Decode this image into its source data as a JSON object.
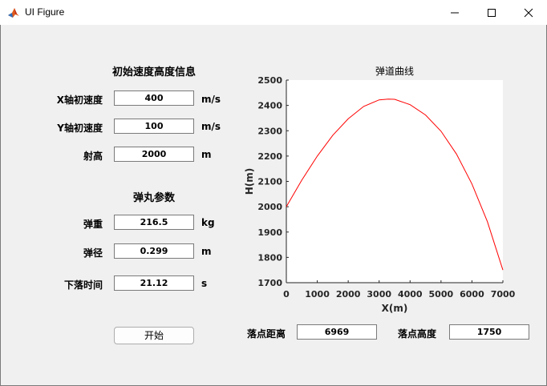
{
  "window": {
    "title": "UI Figure"
  },
  "velocity_section": {
    "title": "初始速度高度信息",
    "x_velocity": {
      "label": "X轴初速度",
      "value": "400",
      "unit": "m/s"
    },
    "y_velocity": {
      "label": "Y轴初速度",
      "value": "100",
      "unit": "m/s"
    },
    "height": {
      "label": "射高",
      "value": "2000",
      "unit": "m"
    }
  },
  "projectile_section": {
    "title": "弹丸参数",
    "weight": {
      "label": "弹重",
      "value": "216.5",
      "unit": "kg"
    },
    "diameter": {
      "label": "弹径",
      "value": "0.299",
      "unit": "m"
    },
    "fall_time": {
      "label": "下落时间",
      "value": "21.12",
      "unit": "s"
    }
  },
  "start_button": {
    "label": "开始"
  },
  "results": {
    "distance": {
      "label": "落点距离",
      "value": "6969"
    },
    "height": {
      "label": "落点高度",
      "value": "1750"
    }
  },
  "chart_data": {
    "type": "line",
    "title": "弹道曲线",
    "xlabel": "X(m)",
    "ylabel": "H(m)",
    "xlim": [
      0,
      7000
    ],
    "ylim": [
      1700,
      2500
    ],
    "xticks": [
      0,
      1000,
      2000,
      3000,
      4000,
      5000,
      6000,
      7000
    ],
    "yticks": [
      1700,
      1800,
      1900,
      2000,
      2100,
      2200,
      2300,
      2400,
      2500
    ],
    "grid": false,
    "series": [
      {
        "color": "#ff0000",
        "x": [
          0,
          500,
          1000,
          1500,
          2000,
          2500,
          3000,
          3300,
          3500,
          4000,
          4500,
          5000,
          5500,
          6000,
          6500,
          7000
        ],
        "y": [
          2000,
          2105,
          2200,
          2282,
          2347,
          2396,
          2422,
          2425,
          2424,
          2403,
          2362,
          2298,
          2208,
          2090,
          1941,
          1750
        ]
      }
    ]
  }
}
